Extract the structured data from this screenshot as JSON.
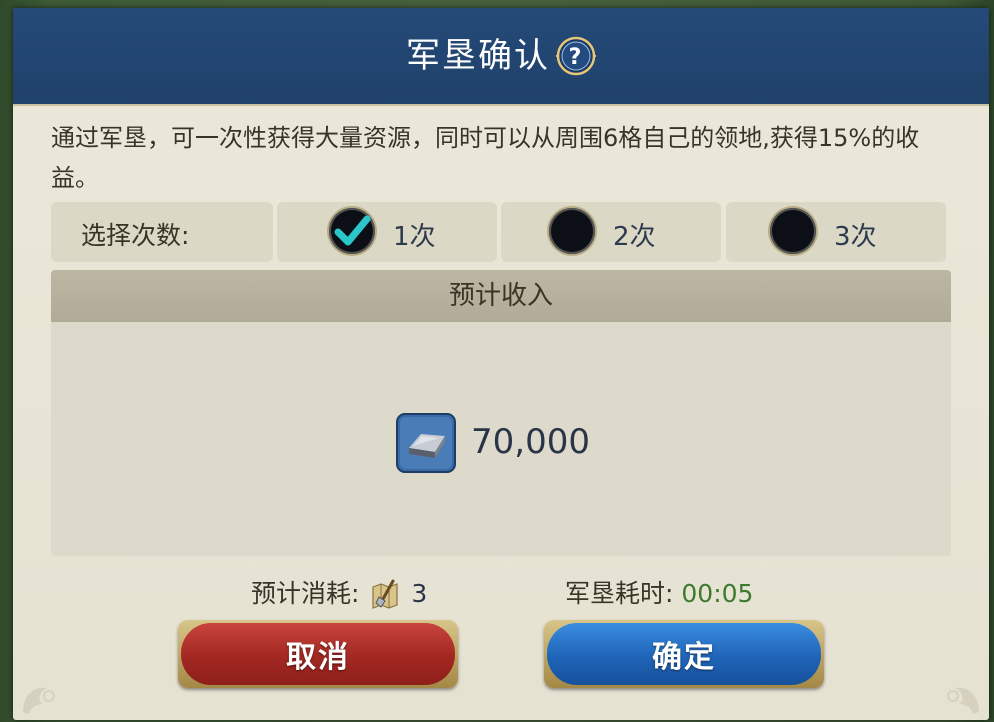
{
  "dialog": {
    "title": "军垦确认",
    "description": "通过军垦，可一次性获得大量资源，同时可以从周围6格自己的领地,获得15%的收益。"
  },
  "selection": {
    "label": "选择次数:",
    "options": [
      {
        "label": "1次",
        "selected": true
      },
      {
        "label": "2次",
        "selected": false
      },
      {
        "label": "3次",
        "selected": false
      }
    ]
  },
  "income": {
    "header": "预计收入",
    "resource_icon": "iron-ingot-icon",
    "amount": "70,000"
  },
  "cost": {
    "label": "预计消耗:",
    "icon": "shovel-map-icon",
    "amount": "3"
  },
  "duration": {
    "label": "军垦耗时:",
    "value": "00:05"
  },
  "buttons": {
    "cancel": "取消",
    "confirm": "确定"
  },
  "colors": {
    "title_bar": "#254a78",
    "panel": "#ebe8da",
    "checkmark": "#2bc6c9",
    "time_value": "#3d7a30",
    "cancel_button": "#a32822",
    "confirm_button": "#1f64b8"
  }
}
